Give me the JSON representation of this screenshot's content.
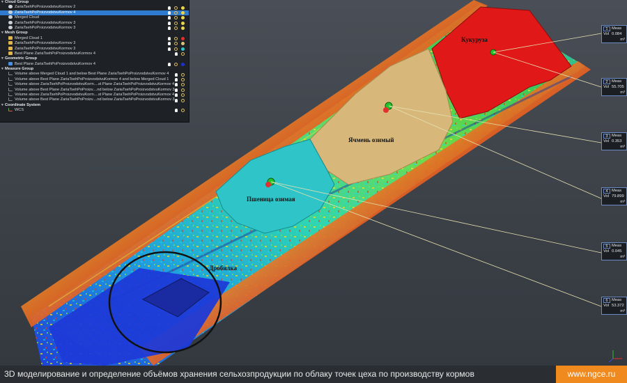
{
  "tree": {
    "groups": [
      {
        "name": "Cloud Group",
        "items": [
          {
            "label": "ZariaTsehPoProizvodstvuKormov 2",
            "icon": "cloud-icon",
            "color": "#e8d44d"
          },
          {
            "label": "ZariaTsehPoProizvodstvuKormov 4",
            "icon": "cloud-icon",
            "color": "#e8d44d",
            "selected": true
          },
          {
            "label": "Merged Cloud",
            "icon": "cloud-icon",
            "color": "#e8d44d"
          },
          {
            "label": "ZariaTsehPoProizvodstvuKormov 3",
            "icon": "cloud-icon",
            "color": "#e8d44d"
          },
          {
            "label": "ZariaTsehPoProizvodstvuKormov 3",
            "icon": "cloud-icon",
            "color": "#e8d44d"
          }
        ]
      },
      {
        "name": "Mesh Group",
        "items": [
          {
            "label": "Merged Cloud 1",
            "icon": "mesh-icon",
            "color": "#e03030"
          },
          {
            "label": "ZariaTsehPoProizvodstvuKormov 3",
            "icon": "mesh-icon",
            "color": "#d8c27a"
          },
          {
            "label": "ZariaTsehPoProizvodstvuKormov 3",
            "icon": "mesh-icon",
            "color": "#2bc6c8"
          },
          {
            "label": "Best Plane ZariaTsehPoProizvodstvuKormov 4",
            "icon": "mesh-icon",
            "color": ""
          }
        ]
      },
      {
        "name": "Geometric Group",
        "items": [
          {
            "label": "Best Plane ZariaTsehPoProizvodstvuKormov 4",
            "icon": "plane-icon",
            "color": "#2030d0"
          }
        ]
      },
      {
        "name": "Measure Group",
        "items": [
          {
            "label": "Volume above Merged Cloud 1 and below Best Plane ZariaTsehPoProizvodstvuKormov 4",
            "icon": "measure-icon",
            "color": ""
          },
          {
            "label": "Volume above Best Plane ZariaTsehPoProizvodstvuKormov 4 and below Merged Cloud 1",
            "icon": "measure-icon",
            "color": ""
          },
          {
            "label": "Volume above ZariaTsehPoProizvodstvuKorm....st Plane ZariaTsehPoProizvodstvuKormov 4",
            "icon": "measure-icon",
            "color": ""
          },
          {
            "label": "Volume above Best Plane ZariaTsehPoProizv....nd below ZariaTsehPoProizvodstvuKormov 3",
            "icon": "measure-icon",
            "color": ""
          },
          {
            "label": "Volume above ZariaTsehPoProizvodstvuKorm....st Plane ZariaTsehPoProizvodstvuKormov 4",
            "icon": "measure-icon",
            "color": ""
          },
          {
            "label": "Volume above Best Plane ZariaTsehPoProizv....nd below ZariaTsehPoProizvodstvuKormov 3",
            "icon": "measure-icon",
            "color": ""
          }
        ]
      },
      {
        "name": "Coordinate System",
        "items": [
          {
            "label": "WCS",
            "icon": "axes-icon",
            "color": ""
          }
        ]
      }
    ]
  },
  "measurements": [
    {
      "num": "1",
      "title": "Meas",
      "vol_label": "Vol",
      "value": "0.084",
      "unit": "m³"
    },
    {
      "num": "2",
      "title": "Meas",
      "vol_label": "Vol",
      "value": "55.705",
      "unit": "m³"
    },
    {
      "num": "3",
      "title": "Meas",
      "vol_label": "Vol",
      "value": "0.353",
      "unit": "m³"
    },
    {
      "num": "4",
      "title": "Meas",
      "vol_label": "Vol",
      "value": "79.899",
      "unit": "m³"
    },
    {
      "num": "5",
      "title": "Meas",
      "vol_label": "Vol",
      "value": "0.045",
      "unit": "m³"
    },
    {
      "num": "6",
      "title": "Meas",
      "vol_label": "Vol",
      "value": "53.372",
      "unit": "m³"
    }
  ],
  "labels": {
    "corn": "Кукуруза",
    "barley": "Ячмень озимый",
    "wheat": "Пшеница озимая",
    "crusher": "Дробилка"
  },
  "caption": {
    "text": "3D моделирование и определение объёмов хранения сельхозпродукции по облаку точек цеха по производству кормов",
    "site": "www.ngce.ru"
  },
  "colors": {
    "corn": "#e01818",
    "barley": "#d8b77a",
    "wheat": "#2ec4c8",
    "accent": "#f08a1e"
  }
}
